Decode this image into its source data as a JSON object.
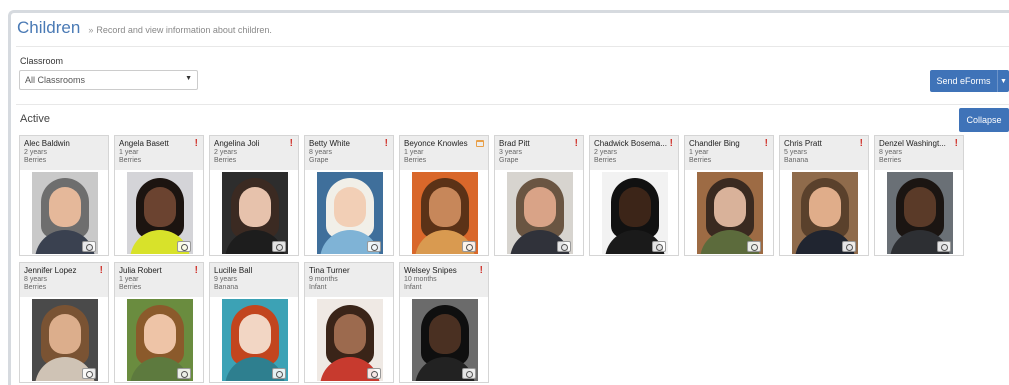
{
  "header": {
    "title": "Children",
    "subtitle": "Record and view information about children."
  },
  "filter": {
    "label": "Classroom",
    "selected": "All Classrooms"
  },
  "actions": {
    "send_eforms": "Send eForms",
    "collapse": "Collapse"
  },
  "section": {
    "title": "Active"
  },
  "children": [
    {
      "name": "Alec Baldwin",
      "age": "2 years",
      "group": "Berries",
      "flag": "none",
      "colors": [
        "#6e6e6e",
        "#e5b89a",
        "#3a4150",
        "#c9c9c9"
      ]
    },
    {
      "name": "Angela Basett",
      "age": "1 year",
      "group": "Berries",
      "flag": "alert",
      "colors": [
        "#1c1410",
        "#6b4330",
        "#d8e22a",
        "#d4d4d8"
      ]
    },
    {
      "name": "Angelina Joli",
      "age": "2 years",
      "group": "Berries",
      "flag": "alert",
      "colors": [
        "#3b2a22",
        "#e7c2ac",
        "#1d1d1d",
        "#2d2d2d"
      ]
    },
    {
      "name": "Betty White",
      "age": "8 years",
      "group": "Grape",
      "flag": "alert",
      "colors": [
        "#f1efe8",
        "#f2cfb6",
        "#7fb3d6",
        "#3f6f9b"
      ]
    },
    {
      "name": "Beyonce Knowles",
      "age": "1 year",
      "group": "Berries",
      "flag": "calendar",
      "colors": [
        "#5b3217",
        "#c7875a",
        "#d99a50",
        "#d9672a"
      ]
    },
    {
      "name": "Brad Pitt",
      "age": "3 years",
      "group": "Grape",
      "flag": "alert",
      "colors": [
        "#6a5542",
        "#d9a387",
        "#30323a",
        "#d7d4cf"
      ]
    },
    {
      "name": "Chadwick Bosema...",
      "age": "2 years",
      "group": "Berries",
      "flag": "alert",
      "colors": [
        "#111111",
        "#3c2518",
        "#1a1a1a",
        "#f2f2f2"
      ]
    },
    {
      "name": "Chandler Bing",
      "age": "1 year",
      "group": "Berries",
      "flag": "alert",
      "colors": [
        "#3a2a20",
        "#d9b29a",
        "#5c6b3c",
        "#9d6b44"
      ]
    },
    {
      "name": "Chris Pratt",
      "age": "5 years",
      "group": "Banana",
      "flag": "alert",
      "colors": [
        "#5a412c",
        "#e0ad8a",
        "#202530",
        "#8f6b4b"
      ]
    },
    {
      "name": "Denzel Washingt...",
      "age": "8 years",
      "group": "Berries",
      "flag": "alert",
      "colors": [
        "#1b1512",
        "#5a3a28",
        "#2d2f33",
        "#6a7076"
      ]
    },
    {
      "name": "Jennifer Lopez",
      "age": "8 years",
      "group": "Berries",
      "flag": "alert",
      "colors": [
        "#7a5333",
        "#dcae8c",
        "#cfc3b5",
        "#4a4a4a"
      ]
    },
    {
      "name": "Julia Robert",
      "age": "1 year",
      "group": "Berries",
      "flag": "alert",
      "colors": [
        "#8b5a2b",
        "#eec4a7",
        "#5d7a3e",
        "#6a8c3f"
      ]
    },
    {
      "name": "Lucille Ball",
      "age": "9 years",
      "group": "Banana",
      "flag": "none",
      "colors": [
        "#c2451e",
        "#f2d6c4",
        "#2e7f8f",
        "#3ca2b5"
      ]
    },
    {
      "name": "Tina Turner",
      "age": "9 months",
      "group": "Infant",
      "flag": "none",
      "colors": [
        "#3a2418",
        "#9c6a4e",
        "#c73a2e",
        "#efe9e4"
      ]
    },
    {
      "name": "Welsey Snipes",
      "age": "10 months",
      "group": "Infant",
      "flag": "alert",
      "colors": [
        "#0f0f0f",
        "#4a3022",
        "#222222",
        "#6b6b6b"
      ]
    }
  ]
}
